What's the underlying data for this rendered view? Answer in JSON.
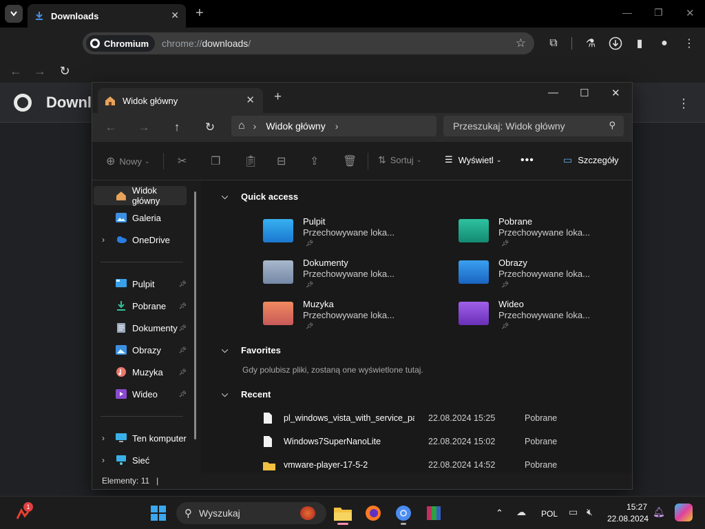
{
  "chrome": {
    "tab_title": "Downloads",
    "chip_label": "Chromium",
    "url_prefix": "chrome://",
    "url_host": "downloads",
    "url_suffix": "/",
    "page_title": "Downl"
  },
  "explorer": {
    "tab_title": "Widok główny",
    "address_label": "Widok główny",
    "search_placeholder": "Przeszukaj: Widok główny",
    "cmd": {
      "new": "Nowy",
      "sort": "Sortuj",
      "view": "Wyświetl",
      "details": "Szczegóły"
    },
    "sidebar": [
      {
        "label": "Widok główny",
        "icon": "home-icon"
      },
      {
        "label": "Galeria",
        "icon": "gallery-icon"
      },
      {
        "label": "OneDrive",
        "icon": "cloud-icon"
      },
      {
        "label": "Pulpit",
        "icon": "desktop-icon"
      },
      {
        "label": "Pobrane",
        "icon": "download-icon"
      },
      {
        "label": "Dokumenty",
        "icon": "document-icon"
      },
      {
        "label": "Obrazy",
        "icon": "pictures-icon"
      },
      {
        "label": "Muzyka",
        "icon": "music-icon"
      },
      {
        "label": "Wideo",
        "icon": "video-icon"
      },
      {
        "label": "Ten komputer",
        "icon": "computer-icon"
      },
      {
        "label": "Sieć",
        "icon": "network-icon"
      }
    ],
    "sections": {
      "quick_access": "Quick access",
      "favorites": "Favorites",
      "favorites_note": "Gdy polubisz pliki, zostaną one wyświetlone tutaj.",
      "recent": "Recent"
    },
    "quick_access": [
      {
        "name": "Pulpit",
        "sub": "Przechowywane loka...",
        "color": "#1e90e0"
      },
      {
        "name": "Pobrane",
        "sub": "Przechowywane loka...",
        "color": "#1aa68a"
      },
      {
        "name": "Dokumenty",
        "sub": "Przechowywane loka...",
        "color": "#8a9cb8"
      },
      {
        "name": "Obrazy",
        "sub": "Przechowywane loka...",
        "color": "#2a86d8"
      },
      {
        "name": "Muzyka",
        "sub": "Przechowywane loka...",
        "color": "#e0785a"
      },
      {
        "name": "Wideo",
        "sub": "Przechowywane loka...",
        "color": "#8a4ad0"
      }
    ],
    "recent": [
      {
        "name": "pl_windows_vista_with_service_pa...",
        "date": "22.08.2024 15:25",
        "location": "Pobrane",
        "icon": "file-icon"
      },
      {
        "name": "Windows7SuperNanoLite",
        "date": "22.08.2024 15:02",
        "location": "Pobrane",
        "icon": "file-icon"
      },
      {
        "name": "vmware-player-17-5-2",
        "date": "22.08.2024 14:52",
        "location": "Pobrane",
        "icon": "folder-icon"
      }
    ],
    "status": "Elementy: 11"
  },
  "taskbar": {
    "search_label": "Wyszukaj",
    "badge": "1",
    "lang": "POL",
    "time": "15:27",
    "date": "22.08.2024"
  }
}
